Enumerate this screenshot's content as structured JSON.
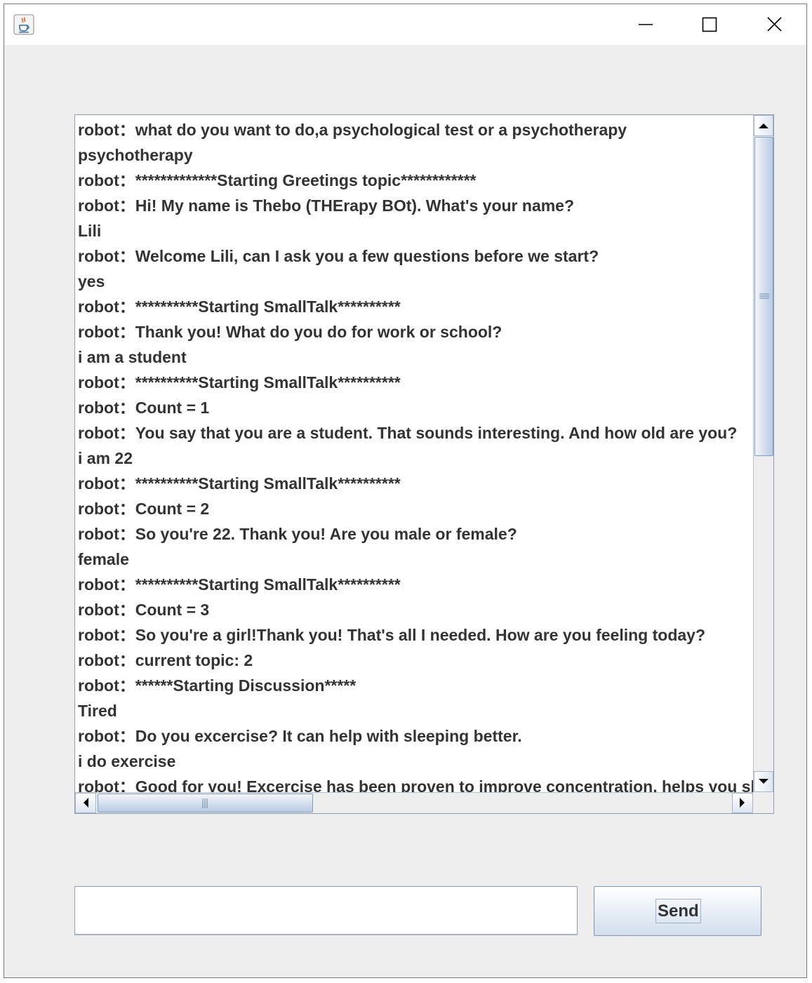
{
  "window": {
    "app_icon": "java-cup-icon",
    "controls": [
      "minimize-icon",
      "maximize-icon",
      "close-icon"
    ]
  },
  "chat": {
    "lines": [
      "robot：what do you want to do,a psychological test or a psychotherapy",
      "psychotherapy",
      "robot：*************Starting Greetings topic************",
      "robot：Hi! My name is Thebo (THErapy BOt). What's your name?",
      "Lili",
      "robot：Welcome Lili, can I ask you a few questions before we start?",
      "yes",
      "robot：**********Starting SmallTalk**********",
      "robot：Thank you! What do you do for work or school?",
      "i am a student",
      "robot：**********Starting SmallTalk**********",
      "robot：Count = 1",
      "robot：You say that you are a  student. That sounds interesting. And how old are you?",
      "i am 22",
      "robot：**********Starting SmallTalk**********",
      "robot：Count = 2",
      "robot：So you're 22. Thank you! Are you male or female?",
      "female",
      "robot：**********Starting SmallTalk**********",
      "robot：Count = 3",
      "robot：So you're a girl!Thank you! That's all I needed. How are you feeling today?",
      "robot：current topic: 2",
      "robot：******Starting Discussion*****",
      "Tired",
      "robot：Do you excercise? It can help with sleeping better.",
      "i do exercise",
      "robot：Good for you! Excercise has been proven to improve concentration, helps you sleep"
    ]
  },
  "input": {
    "value": ""
  },
  "send_button": {
    "label": "Send"
  },
  "colors": {
    "window_background": "#eeeeee",
    "text": "#333333",
    "scroll_thumb": "#cfdbeb",
    "border": "#8f9caf"
  }
}
